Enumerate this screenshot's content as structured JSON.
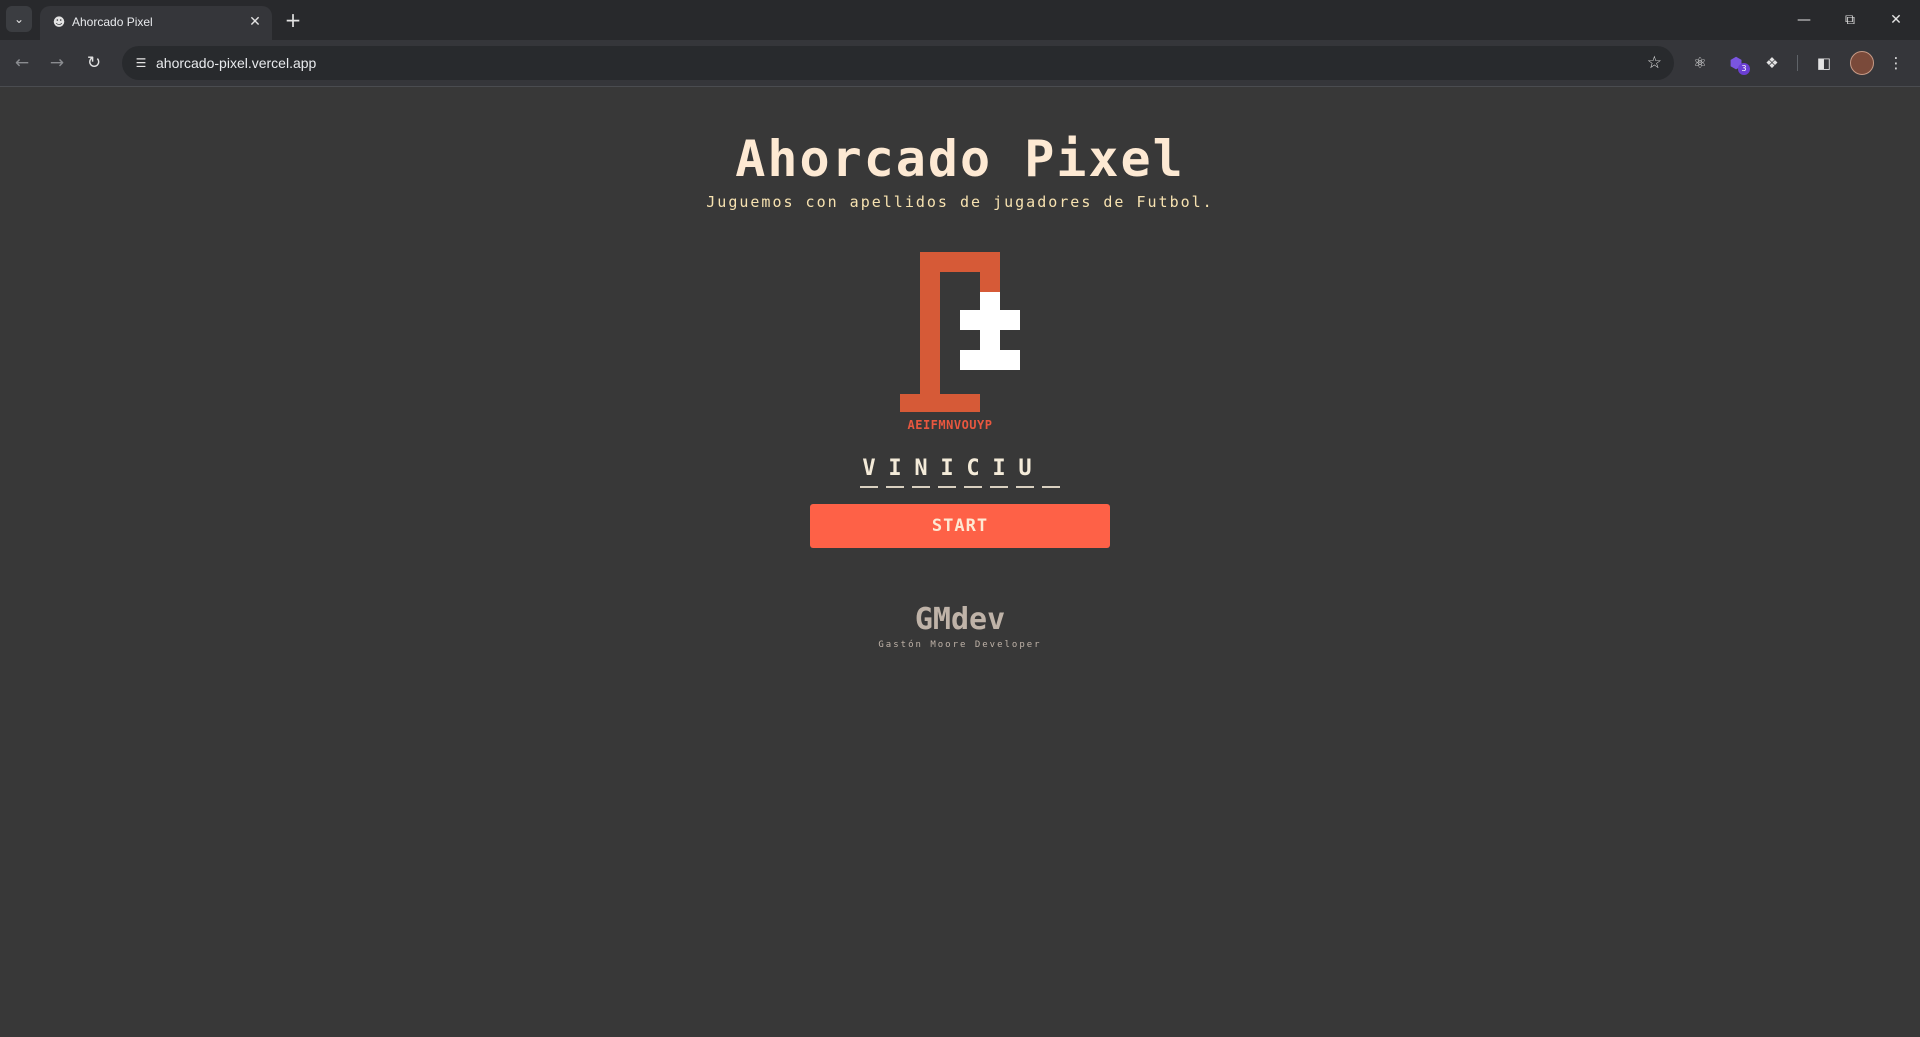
{
  "browser": {
    "tab_title": "Ahorcado Pixel",
    "url": "ahorcado-pixel.vercel.app",
    "extension_badge": "3",
    "icons": {
      "tab_search": "chevron-down-icon",
      "favicon": "person-icon",
      "close_tab": "close-icon",
      "new_tab": "plus-icon",
      "back": "arrow-left-icon",
      "forward": "arrow-right-icon",
      "reload": "reload-icon",
      "site_info": "tune-icon",
      "bookmark": "star-icon",
      "extensions": "puzzle-icon",
      "side_panel": "side-panel-icon",
      "menu": "more-vert-icon"
    }
  },
  "game": {
    "title": "Ahorcado Pixel",
    "subtitle": "Juguemos con apellidos de jugadores de Futbol.",
    "used_letters": "AEIFMNVOUYP",
    "word_slots": [
      "V",
      "I",
      "N",
      "I",
      "C",
      "I",
      "U",
      ""
    ],
    "start_label": "START",
    "accent_color": "#fe6147",
    "gallows_color": "#d65a37"
  },
  "footer": {
    "logo": "GMdev",
    "tagline": "Gastón Moore Developer"
  }
}
